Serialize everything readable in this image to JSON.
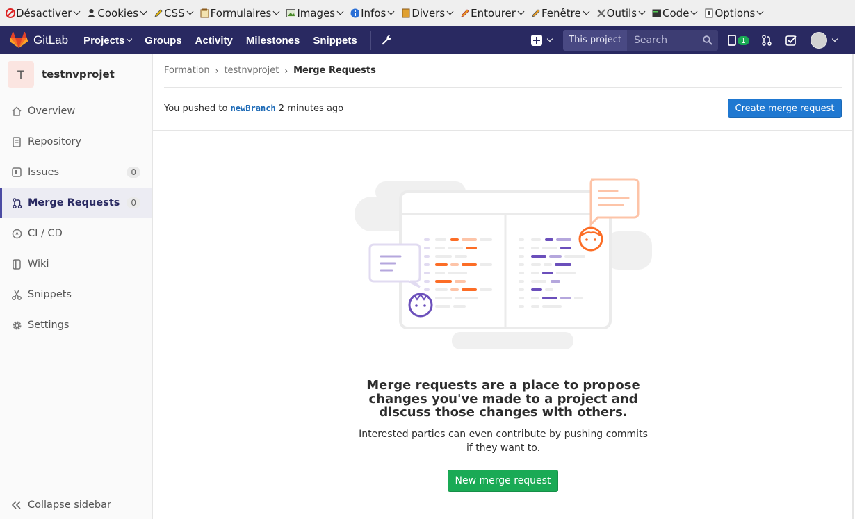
{
  "webdev_toolbar": {
    "items": [
      {
        "label": "Désactiver",
        "icon": "disable-icon"
      },
      {
        "label": "Cookies",
        "icon": "cookie-icon"
      },
      {
        "label": "CSS",
        "icon": "css-pencil-icon"
      },
      {
        "label": "Formulaires",
        "icon": "forms-icon"
      },
      {
        "label": "Images",
        "icon": "image-icon"
      },
      {
        "label": "Infos",
        "icon": "info-icon"
      },
      {
        "label": "Divers",
        "icon": "misc-book-icon"
      },
      {
        "label": "Entourer",
        "icon": "outline-pencil-icon"
      },
      {
        "label": "Fenêtre",
        "icon": "window-pencil-icon"
      },
      {
        "label": "Outils",
        "icon": "tools-icon"
      },
      {
        "label": "Code",
        "icon": "code-icon"
      },
      {
        "label": "Options",
        "icon": "options-icon"
      }
    ]
  },
  "topnav": {
    "brand": "GitLab",
    "links": [
      "Projects",
      "Groups",
      "Activity",
      "Milestones",
      "Snippets"
    ],
    "search_scope": "This project",
    "search_placeholder": "Search",
    "todo_count": "1",
    "colors": {
      "nav_bg": "#292961",
      "accent_orange": "#fc6d26"
    }
  },
  "sidebar": {
    "project_initial": "T",
    "project_name": "testnvprojet",
    "items": [
      {
        "label": "Overview",
        "icon": "home-icon"
      },
      {
        "label": "Repository",
        "icon": "doc-icon"
      },
      {
        "label": "Issues",
        "icon": "issues-icon",
        "count": "0"
      },
      {
        "label": "Merge Requests",
        "icon": "merge-request-icon",
        "count": "0",
        "active": true
      },
      {
        "label": "CI / CD",
        "icon": "rocket-icon"
      },
      {
        "label": "Wiki",
        "icon": "book-icon"
      },
      {
        "label": "Snippets",
        "icon": "scissors-icon"
      },
      {
        "label": "Settings",
        "icon": "gear-icon"
      }
    ],
    "collapse_label": "Collapse sidebar"
  },
  "breadcrumb": [
    "Formation",
    "testnvprojet",
    "Merge Requests"
  ],
  "push_banner": {
    "prefix": "You pushed to",
    "branch": "newBranch",
    "time": "2 minutes ago",
    "button": "Create merge request"
  },
  "empty_state": {
    "title": "Merge requests are a place to propose changes you've made to a project and discuss those changes with others.",
    "description": "Interested parties can even contribute by pushing commits if they want to.",
    "button": "New merge request"
  }
}
